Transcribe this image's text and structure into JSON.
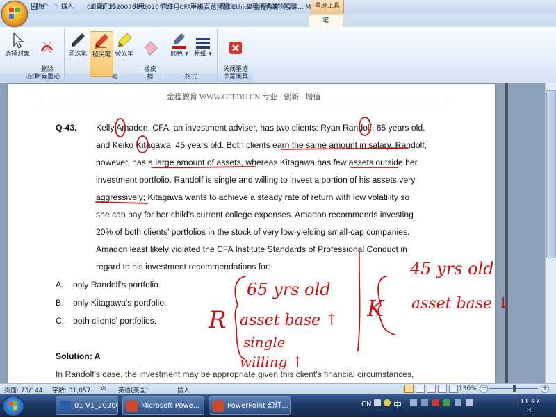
{
  "titlebar": {
    "title": "01 V1_20200708_2020年12月CFA一级百题预测_Ethics_金程教育（授课...",
    "title_suffix": "M",
    "context_tab": "墨迹工具",
    "icons": [
      "save-icon",
      "undo-icon",
      "redo-icon"
    ]
  },
  "tabs": [
    "开始",
    "插入",
    "页面布局",
    "引用",
    "邮件",
    "审阅",
    "视图",
    "福昕阅读器领鲜版",
    "笔"
  ],
  "ribbon": {
    "groups": {
      "select": {
        "label": "选择",
        "buttons": [
          "选择对象",
          "删除\n所有墨迹"
        ]
      },
      "pens": {
        "label": "笔",
        "buttons": [
          "圆珠笔",
          "毡尖笔",
          "荧光笔",
          "橡皮\n擦"
        ]
      },
      "format": {
        "label": "格式",
        "buttons": [
          "颜色",
          "粗细"
        ]
      },
      "close": {
        "label": "关闭",
        "buttons": [
          "关闭墨迹\n书写工具"
        ]
      }
    }
  },
  "document": {
    "header": "金程教育 WWW.GFEDU.CN 专业 · 创新 · 增值",
    "question_number": "Q-43.",
    "question_lines": [
      "Kelly Amadon, CFA, an investment adviser, has two clients: Ryan Randolf, 65 years old,",
      "and Keiko Kitagawa, 45 years old. Both clients earn the same amount in salary. Randolf,",
      "however, has a large amount of assets, whereas Kitagawa has few assets outside her",
      "investment portfolio. Randolf is single and willing to invest a portion of his assets very",
      "aggressively; Kitagawa wants to achieve a steady rate of return with low volatility so",
      "she can pay for her child's current college expenses. Amadon recommends investing",
      "20% of both clients' portfolios in the stock of very low-yielding small-cap companies.",
      "Amadon least likely violated the CFA Institute Standards of Professional Conduct in",
      "regard to his investment recommendations for:"
    ],
    "answers": [
      {
        "letter": "A.",
        "text": "only Randolf's portfolio."
      },
      {
        "letter": "B.",
        "text": "only Kitagawa's portfolio."
      },
      {
        "letter": "C.",
        "text": "both clients' portfolios."
      }
    ],
    "solution_label": "Solution: A",
    "cut_line": "In Randolf's case, the investment may be appropriate given this client's financial circumstances,",
    "ink_notes": {
      "r_label": "R",
      "r_lines": [
        "65 yrs old",
        "asset base ↑",
        "single",
        "willing ↑"
      ],
      "k_label": "K",
      "k_lines": [
        "45 yrs old",
        "asset base ↓"
      ],
      "ink_color": "#d01010"
    }
  },
  "statusbar": {
    "page": "页面: 73/144",
    "words": "字数: 31,057",
    "language": "英语(美国)",
    "mode": "插入",
    "zoom": "130%"
  },
  "taskbar": {
    "tasks": [
      "01 V1_20200708...",
      "Microsoft Powe...",
      "PowerPoint 幻灯..."
    ],
    "tray_lang": "CN",
    "tray_ime": "中",
    "clock_time": "11:47",
    "clock_extra": "8"
  }
}
